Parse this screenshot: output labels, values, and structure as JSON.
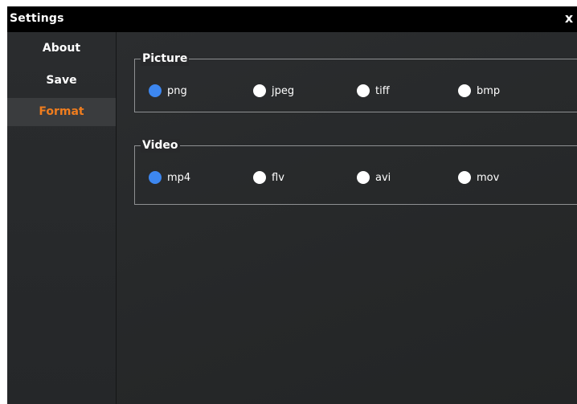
{
  "window": {
    "title": "Settings",
    "close_glyph": "x"
  },
  "sidebar": {
    "items": [
      {
        "label": "About",
        "active": false
      },
      {
        "label": "Save",
        "active": false
      },
      {
        "label": "Format",
        "active": true
      }
    ]
  },
  "picture_group": {
    "legend": "Picture",
    "options": [
      {
        "label": "png",
        "checked": true
      },
      {
        "label": "jpeg",
        "checked": false
      },
      {
        "label": "tiff",
        "checked": false
      },
      {
        "label": "bmp",
        "checked": false
      }
    ]
  },
  "video_group": {
    "legend": "Video",
    "options": [
      {
        "label": "mp4",
        "checked": true
      },
      {
        "label": "flv",
        "checked": false
      },
      {
        "label": "avi",
        "checked": false
      },
      {
        "label": "mov",
        "checked": false
      }
    ]
  },
  "colors": {
    "accent_active_nav": "#f07d1e",
    "radio_checked": "#3d87f0",
    "radio_unchecked": "#ffffff",
    "title_bar": "#000000",
    "panel_background": "#27292b"
  },
  "icons": {
    "close": "close-icon",
    "radio_checked": "radio-checked-icon",
    "radio_unchecked": "radio-unchecked-icon"
  }
}
